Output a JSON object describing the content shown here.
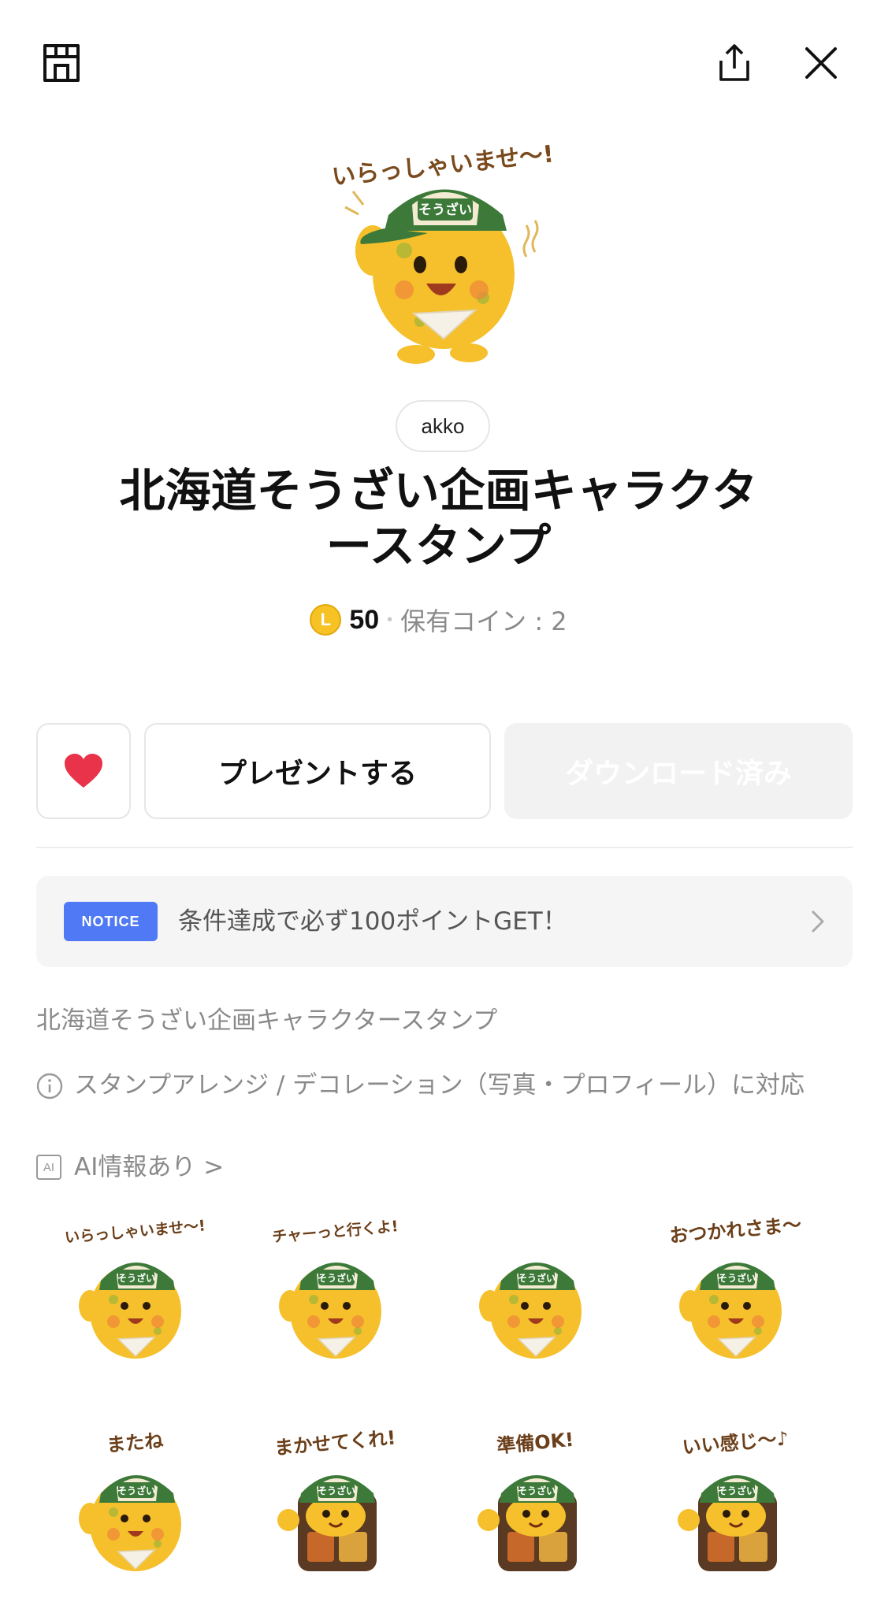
{
  "topbar": {
    "shop_icon": "shop-icon",
    "share_icon": "share-icon",
    "close_icon": "close-icon"
  },
  "hero": {
    "caption": "いらっしゃいませ〜!",
    "cap_label": "そうざい"
  },
  "author": "akko",
  "title_line1": "北海道そうざい企画キャラクタ",
  "title_line2": "ースタンプ",
  "price": {
    "coin_letter": "L",
    "amount": "50",
    "separator": "•",
    "owned": "保有コイン : 2"
  },
  "buttons": {
    "present": "プレゼントする",
    "download": "ダウンロード済み"
  },
  "notice": {
    "badge": "NOTICE",
    "text": "条件達成で必ず100ポイントGET！"
  },
  "description": "北海道そうざい企画キャラクタースタンプ",
  "info": {
    "text": "スタンプアレンジ / デコレーション（写真・プロフィール）に対応"
  },
  "ai": {
    "badge": "AI",
    "text": "AI情報あり >"
  },
  "colors": {
    "accent_blue": "#4f79f5",
    "heart_red": "#e8334a",
    "coin_gold": "#f6c224"
  },
  "stickers": [
    {
      "caption": "いらっしゃいませ〜!",
      "cap": "そうざい",
      "variant": "croquette"
    },
    {
      "caption": "チャーっと行くよ!",
      "cap": "そうざい",
      "variant": "croquette"
    },
    {
      "caption": "",
      "cap": "そうざい",
      "variant": "croquette"
    },
    {
      "caption": "おつかれさま〜",
      "cap": "そうざい",
      "variant": "croquette"
    },
    {
      "caption": "またね",
      "cap": "そうざい",
      "variant": "croquette"
    },
    {
      "caption": "まかせてくれ!",
      "cap": "そうざい",
      "variant": "bento"
    },
    {
      "caption": "準備OK!",
      "cap": "そうざい",
      "variant": "bento"
    },
    {
      "caption": "いい感じ〜♪",
      "cap": "そうざい",
      "variant": "bento"
    }
  ]
}
